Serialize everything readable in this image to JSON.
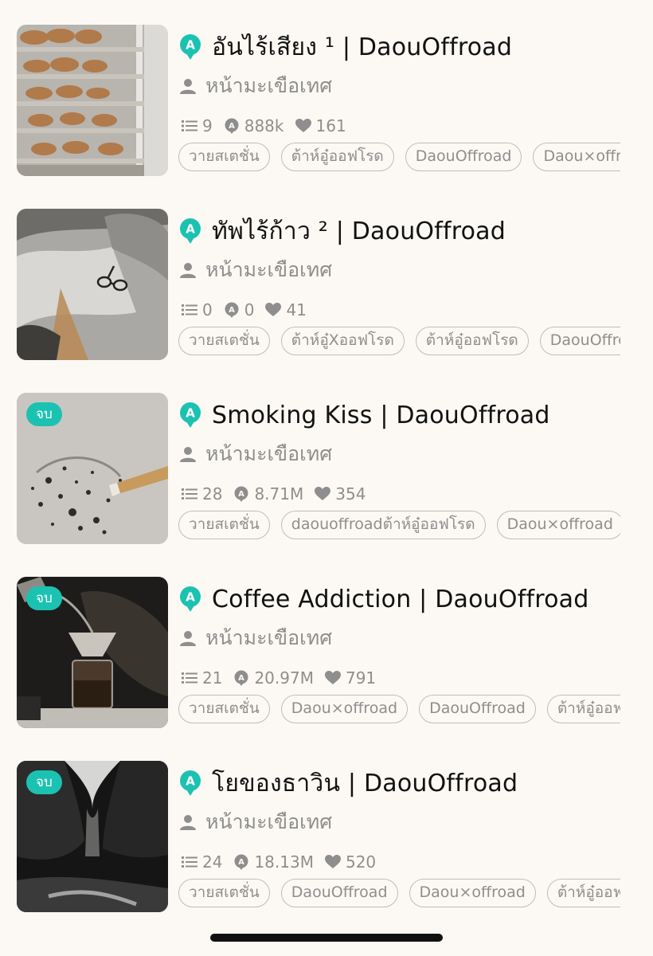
{
  "stories": [
    {
      "title": "อันไร้เสียง ¹ | DaouOffroad",
      "author": "หน้ามะเขือเทศ",
      "badge": null,
      "chapters": "9",
      "views": "888k",
      "likes": "161",
      "tags": [
        "วายสเตชั่น",
        "ต้าห์อู๋ออฟโรด",
        "DaouOffroad",
        "Daou×offroad"
      ],
      "thumb": "pastry-rack"
    },
    {
      "title": "ทัพไร้ก้าว ² | DaouOffroad",
      "author": "หน้ามะเขือเทศ",
      "badge": null,
      "chapters": "0",
      "views": "0",
      "likes": "41",
      "tags": [
        "วายสเตชั่น",
        "ต้าห์อู๋Xออฟโรด",
        "ต้าห์อู๋ออฟโรด",
        "DaouOffroad"
      ],
      "thumb": "bed-glasses"
    },
    {
      "title": "Smoking Kiss | DaouOffroad",
      "author": "หน้ามะเขือเทศ",
      "badge": "จบ",
      "chapters": "28",
      "views": "8.71M",
      "likes": "354",
      "tags": [
        "วายสเตชั่น",
        "daouoffroadต้าห์อู๋ออฟโรด",
        "Daou×offroad"
      ],
      "thumb": "ash-cigarette"
    },
    {
      "title": "Coffee Addiction | DaouOffroad",
      "author": "หน้ามะเขือเทศ",
      "badge": "จบ",
      "chapters": "21",
      "views": "20.97M",
      "likes": "791",
      "tags": [
        "วายสเตชั่น",
        "Daou×offroad",
        "DaouOffroad",
        "ต้าห์อู๋ออฟโรด"
      ],
      "thumb": "coffee-pour"
    },
    {
      "title": "โยของธาวิน | DaouOffroad",
      "author": "หน้ามะเขือเทศ",
      "badge": "จบ",
      "chapters": "24",
      "views": "18.13M",
      "likes": "520",
      "tags": [
        "วายสเตชั่น",
        "DaouOffroad",
        "Daou×offroad",
        "ต้าห์อู๋ออฟโรด"
      ],
      "thumb": "bw-silhouette"
    }
  ],
  "colors": {
    "accent": "#1cc2b1",
    "background": "#fcf9f4",
    "muted": "#8e8e8e"
  },
  "icons": {
    "app": "a-speech-bubble-icon",
    "author": "person-icon",
    "chapters": "list-icon",
    "views": "a-bubble-icon",
    "likes": "heart-icon"
  }
}
